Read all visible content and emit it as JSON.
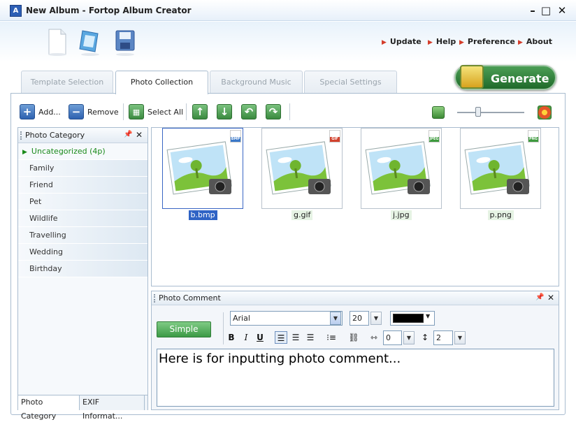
{
  "window": {
    "title": "New Album - Fortop Album Creator",
    "app_icon_text": "A",
    "minimize": "–",
    "maximize": "□",
    "close": "✕"
  },
  "toolbar_links": [
    "Update",
    "Help",
    "Preference",
    "About"
  ],
  "top_icons": [
    "new-document-icon",
    "open-album-icon",
    "save-disk-icon"
  ],
  "tabs": [
    {
      "label": "Template Selection",
      "active": false
    },
    {
      "label": "Photo Collection",
      "active": true
    },
    {
      "label": "Background Music",
      "active": false
    },
    {
      "label": "Special Settings",
      "active": false
    }
  ],
  "generate_label": "Generate",
  "photo_toolbar": {
    "add_label": "Add...",
    "remove_label": "Remove",
    "select_all_label": "Select All",
    "zoom_level": 0.3
  },
  "category_panel": {
    "title": "Photo Category",
    "categories": [
      {
        "label": "Uncategorized  (4p)",
        "selected": true
      },
      {
        "label": "Family"
      },
      {
        "label": "Friend"
      },
      {
        "label": "Pet"
      },
      {
        "label": "Wildlife"
      },
      {
        "label": "Travelling"
      },
      {
        "label": "Wedding"
      },
      {
        "label": "Birthday"
      }
    ],
    "bottom_tabs": [
      "Photo Category",
      "EXIF Informat..."
    ]
  },
  "photos": [
    {
      "name": "b.bmp",
      "badge": "BMP",
      "badge_color": "#3a78c8",
      "selected": true
    },
    {
      "name": "g.gif",
      "badge": "GIF",
      "badge_color": "#d2422d",
      "selected": false
    },
    {
      "name": "j.jpg",
      "badge": "JPEG",
      "badge_color": "#3e9a3e",
      "selected": false
    },
    {
      "name": "p.png",
      "badge": "PNG",
      "badge_color": "#3e9a3e",
      "selected": false
    }
  ],
  "comment_panel": {
    "title": "Photo Comment",
    "simple_label": "Simple",
    "font_name": "Arial",
    "font_size": "20",
    "font_color": "#000000",
    "letter_spacing": "0",
    "line_spacing": "2",
    "text": "Here is for inputting photo comment..."
  },
  "format_buttons": [
    "B",
    "I",
    "U"
  ]
}
